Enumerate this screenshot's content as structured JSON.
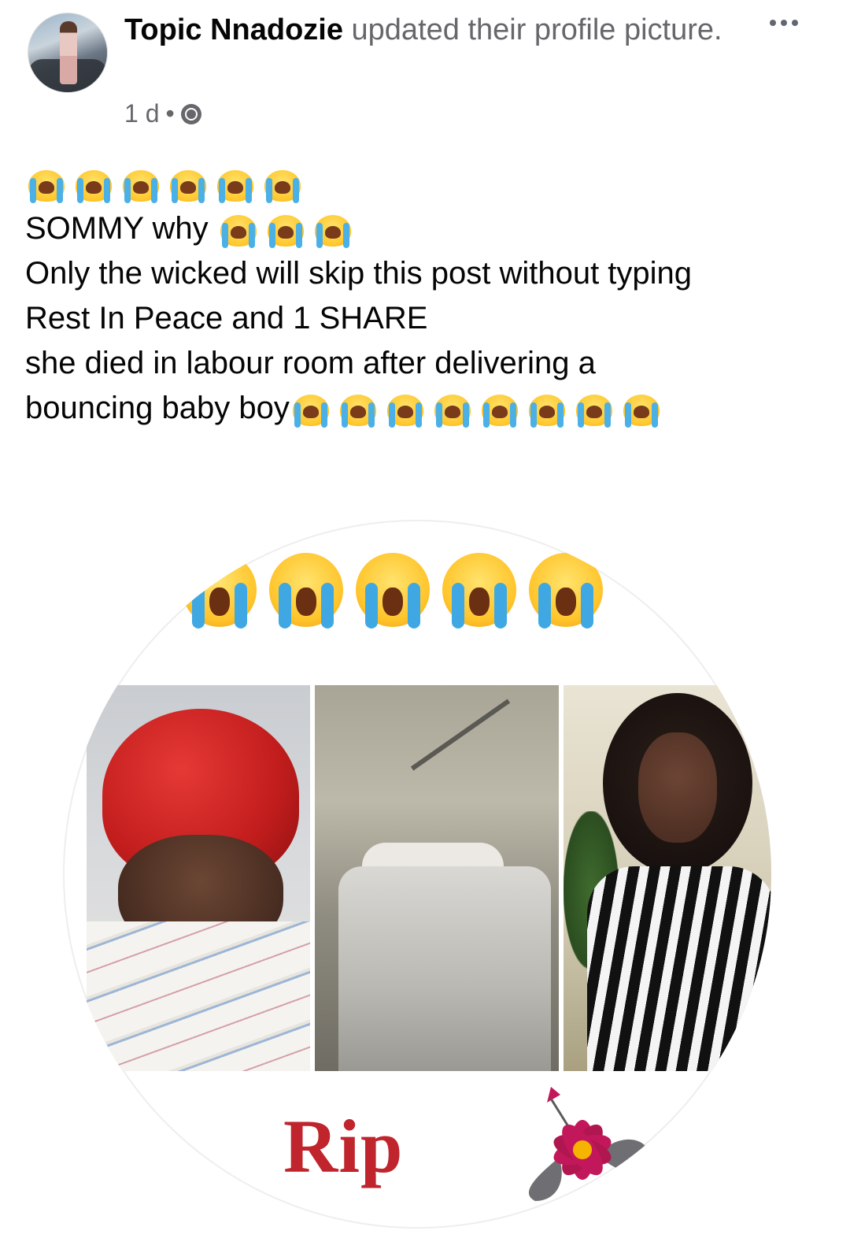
{
  "post": {
    "author": "Topic Nnadozie",
    "action": "updated their profile picture.",
    "time": "1 d",
    "separator": "•",
    "lines": {
      "line2": "SOMMY why",
      "line3": "Only the wicked will skip this post without typing",
      "line4": "Rest In Peace and 1 SHARE",
      "line5": "she died in labour room after delivering a",
      "line6": "bouncing baby boy"
    }
  },
  "photo": {
    "caption_text": "Rip"
  },
  "icons": {
    "more": "more-options-icon",
    "audience": "globe-icon",
    "emoji": "loudly-crying-face-icon"
  },
  "colors": {
    "name": "#050505",
    "secondary": "#65676b",
    "rip": "#c0242c",
    "tears": "#4ab0e6"
  }
}
